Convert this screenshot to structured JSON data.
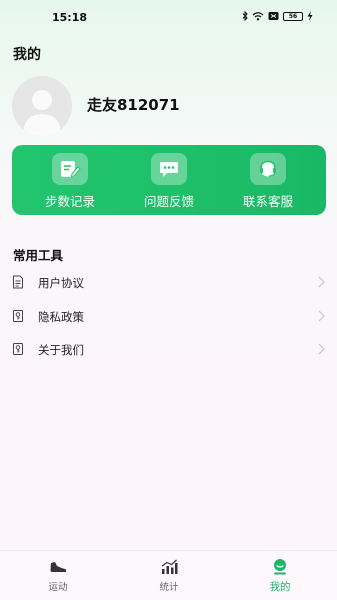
{
  "status_bar": {
    "time": "15:18",
    "battery": "56"
  },
  "header": {
    "title": "我的"
  },
  "profile": {
    "username": "走友812071"
  },
  "quick_actions": [
    {
      "label": "步数记录",
      "icon": "edit-note-icon"
    },
    {
      "label": "问题反馈",
      "icon": "chat-bubble-icon"
    },
    {
      "label": "联系客服",
      "icon": "headset-icon"
    }
  ],
  "tools": {
    "title": "常用工具",
    "items": [
      {
        "label": "用户协议",
        "icon": "document-icon"
      },
      {
        "label": "隐私政策",
        "icon": "privacy-icon"
      },
      {
        "label": "关于我们",
        "icon": "info-icon"
      }
    ]
  },
  "tabbar": {
    "tabs": [
      {
        "label": "运动",
        "icon": "shoe-icon"
      },
      {
        "label": "统计",
        "icon": "stats-icon"
      },
      {
        "label": "我的",
        "icon": "profile-icon"
      }
    ],
    "active_index": 2
  },
  "colors": {
    "accent": "#1fc06a",
    "active_tab": "#1fb46a"
  }
}
